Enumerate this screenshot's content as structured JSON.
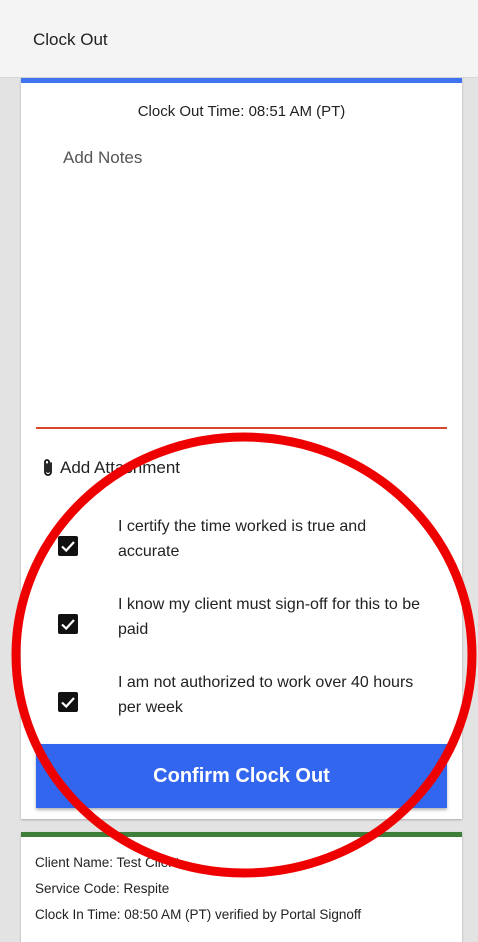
{
  "header": {
    "title": "Clock Out"
  },
  "clock_out": {
    "time_text": "Clock Out Time: 08:51 AM (PT)",
    "notes": {
      "placeholder": "Add Notes",
      "value": ""
    },
    "attachment_label": "Add Attachment",
    "certifications": [
      {
        "label": "I certify the time worked is true and accurate",
        "checked": true
      },
      {
        "label": "I know my client must sign-off for this to be paid",
        "checked": true
      },
      {
        "label": "I am not authorized to work over 40 hours per week",
        "checked": true
      }
    ],
    "confirm_label": "Confirm Clock Out"
  },
  "client_info": {
    "client_name": "Client Name: Test Client",
    "service_code": "Service Code: Respite",
    "clock_in": "Clock In Time: 08:50 AM (PT) verified by Portal Signoff"
  },
  "colors": {
    "accent_blue": "#3366ee",
    "card_top_blue": "#3f74f0",
    "card_top_green": "#3e7d3a",
    "notes_underline": "#d9462a",
    "annotation_red": "#ee0000"
  }
}
